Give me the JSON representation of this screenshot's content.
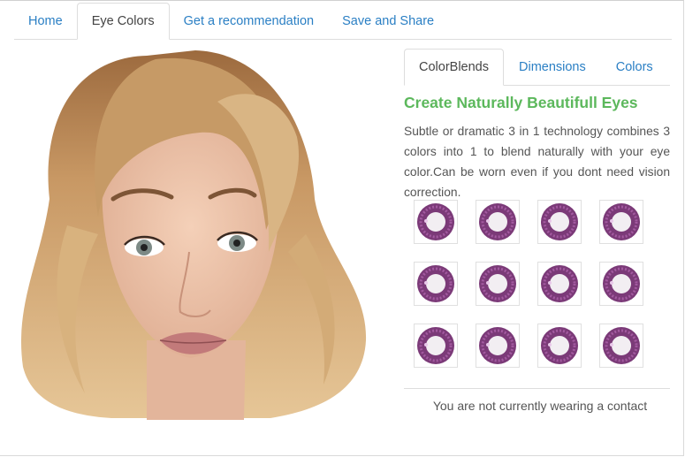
{
  "main_tabs": [
    {
      "label": "Home"
    },
    {
      "label": "Eye Colors"
    },
    {
      "label": "Get a recommendation"
    },
    {
      "label": "Save and Share"
    }
  ],
  "sub_tabs": [
    {
      "label": "ColorBlends"
    },
    {
      "label": "Dimensions"
    },
    {
      "label": "Colors"
    }
  ],
  "content": {
    "heading": "Create Naturally Beautifull Eyes",
    "description": "Subtle or dramatic 3 in 1 technology combines 3 colors into 1 to blend naturally with your eye color.Can be worn even if you dont need vision correction.",
    "status": "You are not currently wearing a contact"
  },
  "lens_swatches": [
    {
      "name": "lens-swatch",
      "color": "#7b3a78"
    },
    {
      "name": "lens-swatch",
      "color": "#7b3a78"
    },
    {
      "name": "lens-swatch",
      "color": "#7b3a78"
    },
    {
      "name": "lens-swatch",
      "color": "#7b3a78"
    },
    {
      "name": "lens-swatch",
      "color": "#7b3a78"
    },
    {
      "name": "lens-swatch",
      "color": "#7b3a78"
    },
    {
      "name": "lens-swatch",
      "color": "#7b3a78"
    },
    {
      "name": "lens-swatch",
      "color": "#7b3a78"
    },
    {
      "name": "lens-swatch",
      "color": "#7b3a78"
    },
    {
      "name": "lens-swatch",
      "color": "#7b3a78"
    },
    {
      "name": "lens-swatch",
      "color": "#7b3a78"
    },
    {
      "name": "lens-swatch",
      "color": "#7b3a78"
    }
  ],
  "colors": {
    "link": "#2a7fc4",
    "heading": "#5cb85c",
    "text": "#555555",
    "border": "#dddddd"
  }
}
